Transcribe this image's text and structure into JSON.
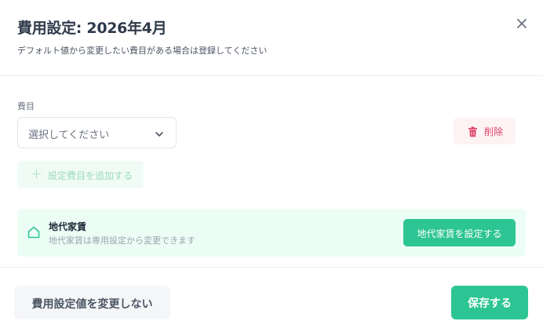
{
  "dialog": {
    "title": "費用設定: 2026年4月",
    "subtitle": "デフォルト値から変更したい費目がある場合は登録してください",
    "close_icon": "close-icon"
  },
  "expense_item": {
    "label": "費目",
    "select_placeholder": "選択してください",
    "delete_label": "削除",
    "delete_icon": "trash-icon"
  },
  "add_button": {
    "label": "設定費目を追加する",
    "icon": "plus-icon"
  },
  "rent_notice": {
    "title": "地代家賃",
    "description": "地代家賃は専用設定から変更できます",
    "button_label": "地代家賃を設定する",
    "icon": "home-icon"
  },
  "footer": {
    "keep_label": "費用設定値を変更しない",
    "save_label": "保存する"
  },
  "colors": {
    "accent": "#2dc593",
    "danger": "#e0466a",
    "notice_bg": "#ecfdf5"
  }
}
